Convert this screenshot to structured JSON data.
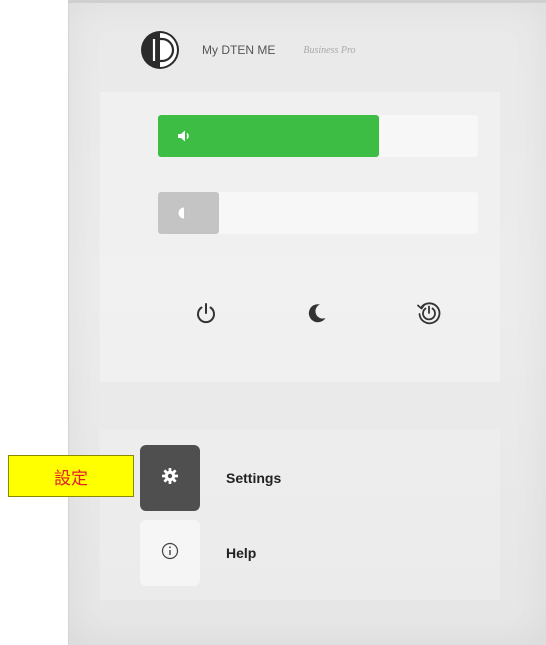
{
  "header": {
    "app_name": "My DTEN ME",
    "plan": "Business Pro",
    "logo_icon": "dten-logo-icon"
  },
  "controls": {
    "volume": {
      "icon": "speaker-icon",
      "level": 0.69,
      "color": "#3ebd44"
    },
    "brightness": {
      "icon": "brightness-icon",
      "level": 0.19,
      "color": "#c4c4c4"
    }
  },
  "power_actions": [
    {
      "name": "power-button",
      "icon": "power-icon"
    },
    {
      "name": "sleep-button",
      "icon": "moon-icon"
    },
    {
      "name": "restart-button",
      "icon": "restart-icon"
    }
  ],
  "menu": {
    "settings": {
      "label": "Settings",
      "icon": "gear-icon"
    },
    "help": {
      "label": "Help",
      "icon": "info-icon"
    }
  },
  "callout": {
    "text": "設定",
    "background": "#ffff00",
    "text_color": "#e0202a"
  }
}
